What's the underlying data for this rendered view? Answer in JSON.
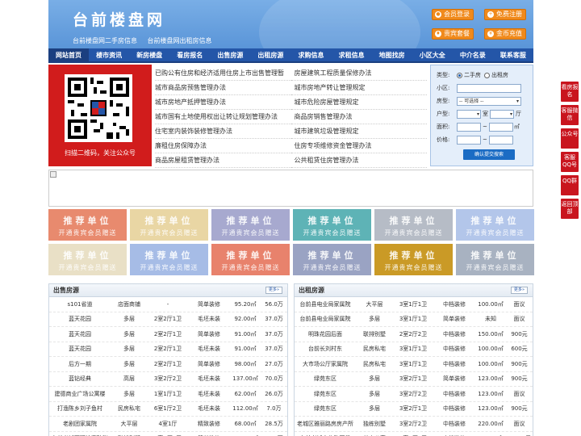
{
  "header": {
    "logo": "台前楼盘网",
    "subtitle_1": "台前楼盘网二手房信息",
    "subtitle_2": "台前楼盘网出租房信息",
    "buttons": [
      "会员登录",
      "免费注册",
      "贵宾套餐",
      "金币充值"
    ]
  },
  "nav": [
    "网站首页",
    "楼市资讯",
    "新房楼盘",
    "看房报名",
    "出售房源",
    "出租房源",
    "求购信息",
    "求租信息",
    "地图找房",
    "小区大全",
    "中介名录",
    "联系客服"
  ],
  "qr": {
    "caption": "扫描二维码，关注公众号"
  },
  "links_left": [
    "已购公有住房和经济适用住房上市出售管理暂",
    "城市商品房预售管理办法",
    "城市房地产抵押管理办法",
    "城市国有土地使用权出让转让规划管理办法",
    "住宅室内装饰装修管理办法",
    "廉租住房保障办法",
    "商品房屋租赁管理办法"
  ],
  "links_right": [
    "房屋建筑工程质量保修办法",
    "城市房地产转让管理规定",
    "城市危险房屋管理规定",
    "商品房销售管理办法",
    "城市建筑垃圾管理规定",
    "住房专项维修资金管理办法",
    "公共租赁住房管理办法"
  ],
  "search": {
    "type_label": "类型:",
    "type_options": [
      "二手房",
      "出租房"
    ],
    "community_label": "小区:",
    "layout_label": "房型:",
    "layout_select": "-- 可选择 --",
    "house_label": "户型:",
    "room_unit": "室",
    "hall_unit": "厅",
    "area_label": "面积:",
    "area_unit": "㎡",
    "price_label": "价格:",
    "range_sep": "~",
    "submit_label": "确认提交搜索"
  },
  "promo": {
    "title": "推荐单位",
    "subtitle": "开通贵宾会员赠送",
    "colors": [
      "#e88a6e",
      "#e9d6a4",
      "#a7a9cf",
      "#5eb3b6",
      "#b6bcc6",
      "#b3c6ea",
      "#e9e0c6",
      "#a6bce6",
      "#e8826c",
      "#9aa3c3",
      "#ca9a26",
      "#a8b2c1"
    ]
  },
  "sale": {
    "title": "出售房源",
    "more": "更多",
    "rows": [
      [
        "s101省道",
        "店面商铺",
        "-",
        "简单装修",
        "95.20㎡",
        "56.0万"
      ],
      [
        "蓝天花园",
        "多层",
        "2室2厅1卫",
        "毛坯未装",
        "92.00㎡",
        "37.0万"
      ],
      [
        "蓝天花园",
        "多层",
        "2室2厅1卫",
        "简单装修",
        "91.00㎡",
        "37.0万"
      ],
      [
        "蓝天花园",
        "多层",
        "2室2厅1卫",
        "毛坯未装",
        "91.00㎡",
        "37.0万"
      ],
      [
        "后方一期",
        "多层",
        "2室2厅1卫",
        "简单装修",
        "98.00㎡",
        "27.0万"
      ],
      [
        "蓝钻经典",
        "高层",
        "3室2厅2卫",
        "毛坯未装",
        "137.00㎡",
        "70.0万"
      ],
      [
        "建德商业广场公寓楼",
        "多层",
        "1室1厅1卫",
        "毛坯未装",
        "62.00㎡",
        "26.0万"
      ],
      [
        "打渔陈乡刘子鱼村",
        "民房私宅",
        "6室1厅2卫",
        "毛坯未装",
        "112.00㎡",
        "7.0万"
      ],
      [
        "老剧团家属院",
        "大平层",
        "4室1厅",
        "精致装修",
        "68.00㎡",
        "28.5万"
      ],
      [
        "台前老城西环检察院附",
        "联排别墅",
        "4室2厅2卫",
        "简单装修",
        "240.00㎡",
        "55.0万"
      ]
    ]
  },
  "rent": {
    "title": "出租房源",
    "more": "更多",
    "rows": [
      [
        "台前县电业局家属院",
        "大平层",
        "3室1厅1卫",
        "中档装修",
        "100.00㎡",
        "面议"
      ],
      [
        "台前县电业局家属院",
        "多层",
        "3室1厅1卫",
        "简单装修",
        "未知",
        "面议"
      ],
      [
        "明珠花园后面",
        "联排别墅",
        "2室2厅2卫",
        "中档装修",
        "150.00㎡",
        "900元"
      ],
      [
        "台前长刘村东",
        "民房私宅",
        "3室1厅1卫",
        "中档装修",
        "100.00㎡",
        "600元"
      ],
      [
        "大市场公厅家属院",
        "民房私宅",
        "3室1厅1卫",
        "中档装修",
        "100.00㎡",
        "900元"
      ],
      [
        "绿苑东区",
        "多层",
        "3室2厅1卫",
        "简单装修",
        "123.00㎡",
        "900元"
      ],
      [
        "绿苑东区",
        "多层",
        "3室2厅2卫",
        "中档装修",
        "123.00㎡",
        "面议"
      ],
      [
        "绿苑东区",
        "多层",
        "3室2厅1卫",
        "中档装修",
        "123.00㎡",
        "900元"
      ],
      [
        "老城区雅丽路房房产所",
        "独栋别墅",
        "3室2厅2卫",
        "中档装修",
        "220.00㎡",
        "面议"
      ],
      [
        "台前老城文化路西段",
        "单身公寓",
        "1室1厅1卫",
        "中档装修",
        "40.00㎡",
        "99999元"
      ]
    ]
  },
  "float": [
    "看房报名",
    "客服微信",
    "公众号",
    "客服QQ号",
    "QQ群",
    "返回顶部"
  ]
}
